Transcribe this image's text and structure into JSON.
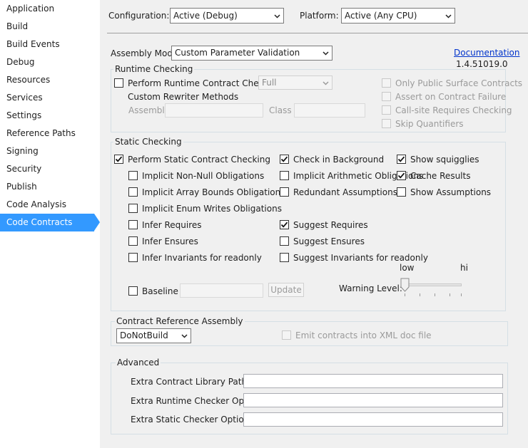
{
  "sidebar": {
    "items": [
      {
        "label": "Application"
      },
      {
        "label": "Build"
      },
      {
        "label": "Build Events"
      },
      {
        "label": "Debug"
      },
      {
        "label": "Resources"
      },
      {
        "label": "Services"
      },
      {
        "label": "Settings"
      },
      {
        "label": "Reference Paths"
      },
      {
        "label": "Signing"
      },
      {
        "label": "Security"
      },
      {
        "label": "Publish"
      },
      {
        "label": "Code Analysis"
      },
      {
        "label": "Code Contracts"
      }
    ],
    "active_item": "Code Contracts"
  },
  "header": {
    "configuration_label": "Configuration:",
    "configuration_value": "Active (Debug)",
    "platform_label": "Platform:",
    "platform_value": "Active (Any CPU)"
  },
  "assembly_mode": {
    "label": "Assembly Mode:",
    "value": "Custom Parameter Validation"
  },
  "documentation_link": "Documentation",
  "version": "1.4.51019.0",
  "runtime": {
    "title": "Runtime Checking",
    "perform_label": "Perform Runtime Contract Checking",
    "level_value": "Full",
    "rewriter_label": "Custom Rewriter Methods",
    "assembly_label": "Assembly",
    "class_label": "Class",
    "only_public_label": "Only Public Surface Contracts",
    "assert_label": "Assert on Contract Failure",
    "callsite_label": "Call-site Requires Checking",
    "skip_label": "Skip Quantifiers"
  },
  "static": {
    "title": "Static Checking",
    "perform_label": "Perform Static Contract Checking",
    "nonnull_label": "Implicit Non-Null Obligations",
    "arraybounds_label": "Implicit Array Bounds Obligations",
    "enumwrites_label": "Implicit Enum Writes Obligations",
    "infer_requires_label": "Infer Requires",
    "infer_ensures_label": "Infer Ensures",
    "infer_invariants_label": "Infer Invariants for readonly",
    "background_label": "Check in Background",
    "arith_label": "Implicit Arithmetic Obligations",
    "redundant_label": "Redundant Assumptions",
    "suggest_requires_label": "Suggest Requires",
    "suggest_ensures_label": "Suggest Ensures",
    "suggest_invariants_label": "Suggest Invariants for readonly",
    "squiggles_label": "Show squigglies",
    "cache_label": "Cache Results",
    "show_assumptions_label": "Show Assumptions",
    "baseline_label": "Baseline",
    "update_label": "Update",
    "warning_label": "Warning Level:",
    "low_label": "low",
    "hi_label": "hi",
    "warning_level": 0
  },
  "checks": {
    "perform_runtime": false,
    "perform_static": true,
    "nonnull": false,
    "arraybounds": false,
    "enumwrites": false,
    "infer_requires": false,
    "infer_ensures": false,
    "infer_invariants": false,
    "background": true,
    "arith": false,
    "redundant": false,
    "suggest_requires": true,
    "suggest_ensures": false,
    "suggest_invariants": false,
    "squiggles": true,
    "cache": true,
    "show_assumptions": false,
    "baseline": false,
    "emit_xml": false
  },
  "reference": {
    "title": "Contract Reference Assembly",
    "value": "DoNotBuild",
    "emit_label": "Emit contracts into XML doc file"
  },
  "advanced": {
    "title": "Advanced",
    "library_label": "Extra Contract Library Paths",
    "runtime_label": "Extra Runtime Checker Options",
    "static_label": "Extra Static Checker Options"
  }
}
